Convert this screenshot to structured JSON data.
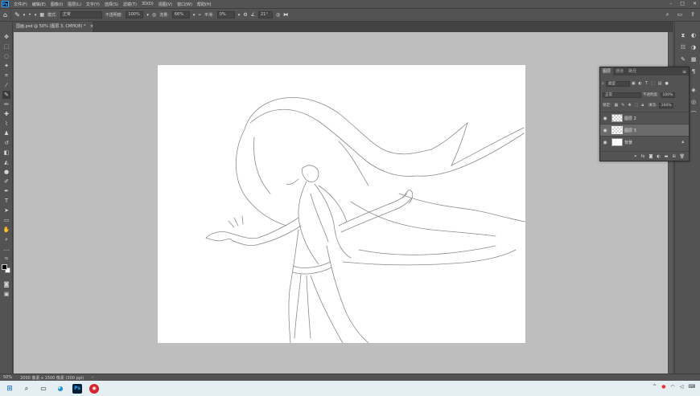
{
  "menubar": {
    "app_logo": "Ps",
    "items": [
      "文件(F)",
      "编辑(E)",
      "图像(I)",
      "图层(L)",
      "文字(Y)",
      "选择(S)",
      "滤镜(T)",
      "3D(D)",
      "视图(V)",
      "窗口(W)",
      "帮助(H)"
    ],
    "window_controls": [
      "–",
      "□",
      "✕"
    ]
  },
  "options": {
    "mode_label": "模式:",
    "mode_value": "正常",
    "opacity_label": "不透明度:",
    "opacity_value": "100%",
    "flow_label": "流量:",
    "flow_value": "66%",
    "smooth_label": "平滑:",
    "smooth_value": "0%",
    "angle_value": "21°"
  },
  "document_tab": {
    "title": "国画.psd @ 50% (图层 3, CMYK/8) *",
    "close": "×"
  },
  "layers_panel": {
    "tabs": [
      "图层",
      "通道",
      "路径"
    ],
    "filter_kind": "类型",
    "blend_mode": "正常",
    "opacity_label": "不透明度:",
    "opacity_value": "100%",
    "lock_label": "锁定:",
    "fill_label": "填充:",
    "fill_value": "100%",
    "layers": [
      {
        "name": "图层 2",
        "selected": false,
        "locked": false
      },
      {
        "name": "图层 3",
        "selected": true,
        "locked": false
      },
      {
        "name": "背景",
        "selected": false,
        "locked": true
      }
    ],
    "footer_icons": [
      "link-icon",
      "fx-icon",
      "mask-icon",
      "adjustment-icon",
      "folder-icon",
      "new-layer-icon",
      "trash-icon"
    ]
  },
  "statusbar": {
    "zoom": "50%",
    "doc_info": "2000 像素 x 1500 像素 (300 ppi)"
  },
  "taskbar": {
    "tray_text": "^"
  }
}
